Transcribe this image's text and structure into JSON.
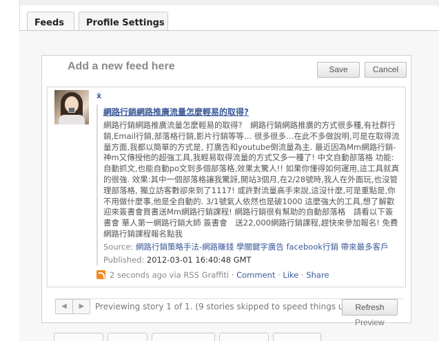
{
  "tabs": [
    {
      "label": "Feeds",
      "active": true
    },
    {
      "label": "Profile Settings",
      "active": false
    }
  ],
  "add_feed": {
    "heading": "Add a new feed here",
    "save_label": "Save",
    "cancel_label": "Cancel"
  },
  "story": {
    "title": "網路行銷網路推廣流量怎麼輕易的取得?",
    "body": "網路行銷網路推廣流量怎麼輕易的取得?　網路行銷網路推廣的方式很多種,有社群行銷,Email行銷,部落格行銷,影片行銷等等… 很多很多…在此不多做說明,可是在取得流量方面,我都以簡單的方式是, 打廣告和youtube倒流量為主. 最近因為Mm網路行銷-神m又傳授他的超強工具,我輕易取得流量的方式又多一種了! 中文自動部落格 功能:自動抓文,也能自動po文到多個部落格,效果太驚人!! 如果你懂得如何運用,這工具就真的很強. 效果:其中一個部落格讓我驚訝,開站3個月,在2/28號時,我人在外面玩,也沒管理部落格, 獨立訪客數卻來到了1117! 或許對流量高手來說,這沒什麼,可是重點是,你不用做什麼事,他是全自動的. 3/1號氣人依然也是破1000 這麼強大的工具,想了解歡迎來簽書會買書送Mm網路行銷課程! 網路行銷很有幫助的自動部落格　請看以下簽書會 華人第一網路行銷大師 簽書會　送22,000網路行銷課程,趕快來參加報名! 免費網路行銷課程報名點我",
    "source_label": "Source:",
    "source_value": "網路行銷策略手法-網路賺錢 學關鍵字廣告 facebook行銷 帶來最多客戶",
    "published_label": "Published:",
    "published_value": "2012-03-01 16:40:48 GMT",
    "posted_ago": "2 seconds ago via RSS Graffiti",
    "comment_label": "Comment",
    "like_label": "Like",
    "share_label": "Share",
    "separator": "·"
  },
  "pager": {
    "prev_glyph": "◀",
    "next_glyph": "▶",
    "status_text": "Previewing story 1 of 1. (9 stories skipped to speed things up).",
    "refresh_label": "Refresh",
    "preview_label": "Preview"
  },
  "icons": {
    "small_icon_glyph": "ẍ"
  },
  "colors": {
    "link": "#3b5998",
    "rss": "#f08a24"
  }
}
